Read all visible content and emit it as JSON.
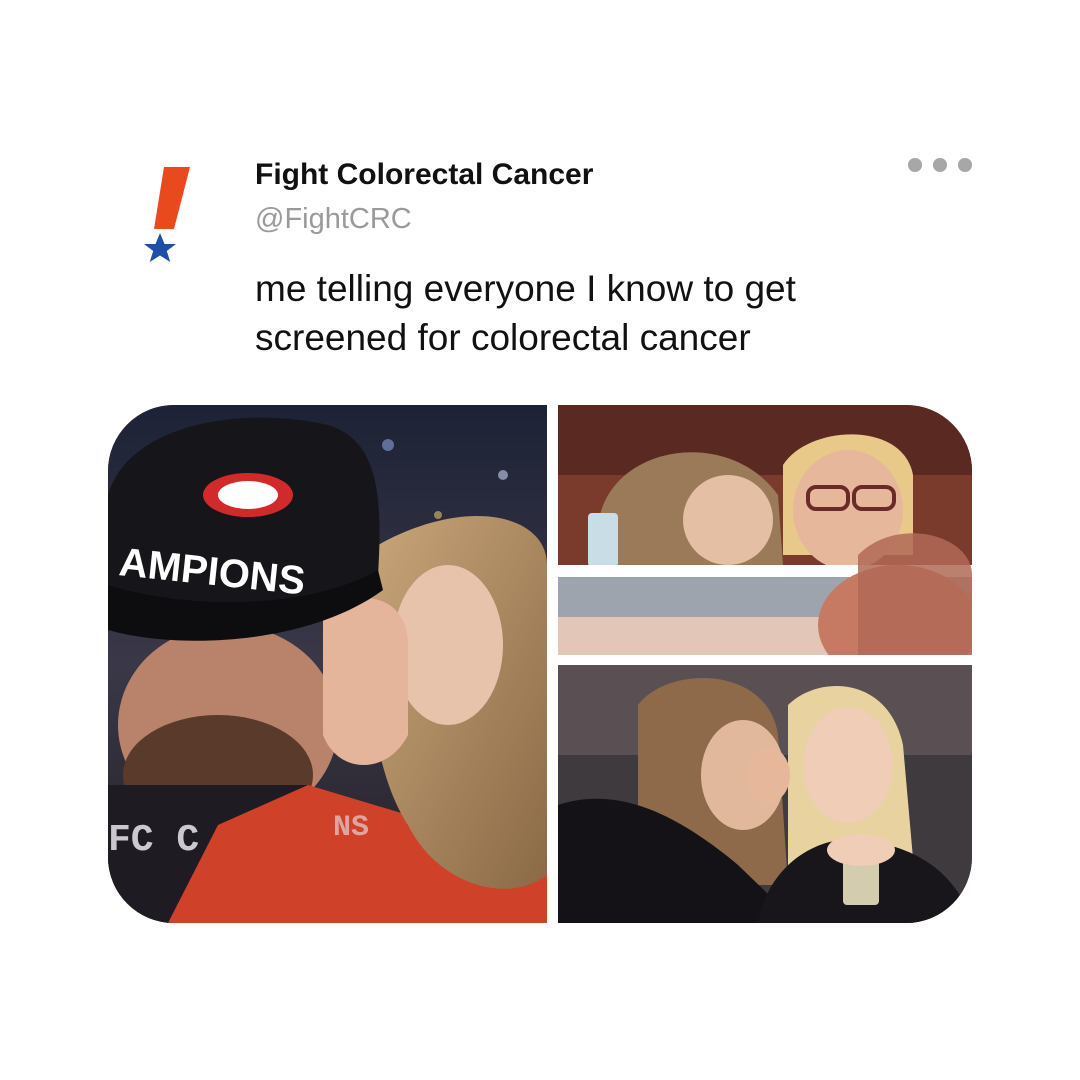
{
  "account": {
    "name": "Fight Colorectal Cancer",
    "handle": "@FightCRC",
    "avatar_icon": "fightcrc-exclamation-star-logo",
    "brand_colors": {
      "exclamation": "#e8491d",
      "star": "#1f4ea6"
    }
  },
  "more_menu": {
    "icon": "more-horizontal-icon",
    "dot_color": "#a7a7a7"
  },
  "tweet": {
    "text_lines": [
      "me telling everyone I know to get",
      "screened for colorectal cancer"
    ]
  },
  "media": {
    "cap_text": "AMPIONS",
    "banner_text": "FC C",
    "banner_text_2": "NS"
  }
}
